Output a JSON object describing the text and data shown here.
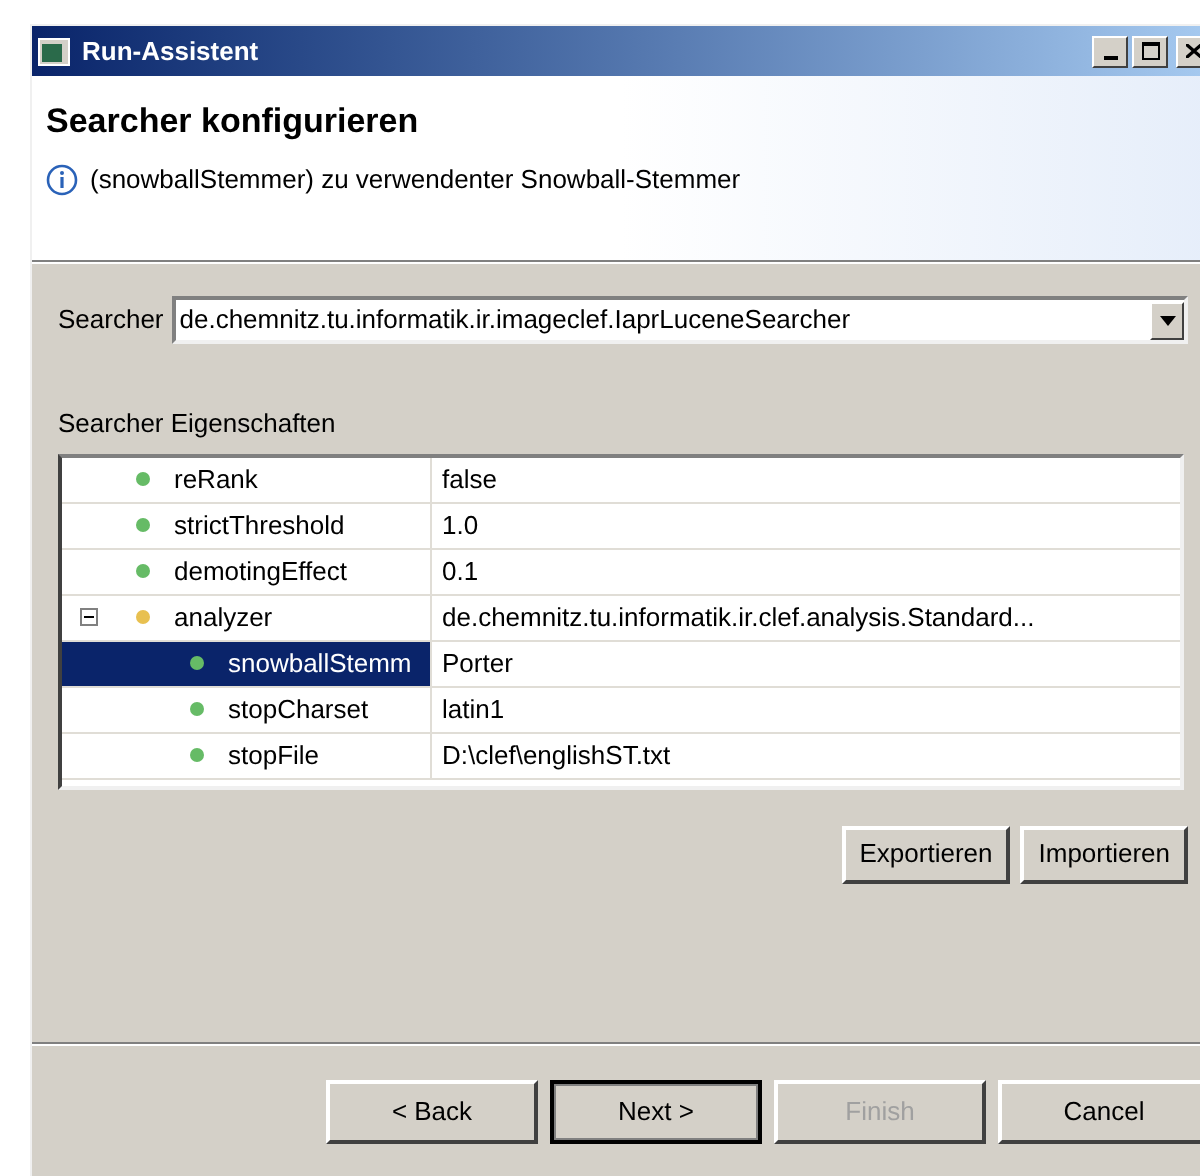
{
  "window": {
    "title": "Run-Assistent"
  },
  "header": {
    "title": "Searcher konfigurieren",
    "message": "(snowballStemmer) zu verwendenter Snowball-Stemmer"
  },
  "searcher": {
    "label": "Searcher",
    "value": "de.chemnitz.tu.informatik.ir.imageclef.IaprLuceneSearcher"
  },
  "properties": {
    "label": "Searcher Eigenschaften",
    "rows": [
      {
        "name": "reRank",
        "value": "false",
        "color": "#66bb66",
        "selected": false
      },
      {
        "name": "strictThreshold",
        "value": "1.0",
        "color": "#66bb66",
        "selected": false
      },
      {
        "name": "demotingEffect",
        "value": "0.1",
        "color": "#66bb66",
        "selected": false
      },
      {
        "name": "analyzer",
        "value": "de.chemnitz.tu.informatik.ir.clef.analysis.Standard...",
        "color": "#e8c050",
        "selected": false,
        "expanded": true,
        "children": [
          {
            "name": "snowballStemm",
            "value": "Porter",
            "color": "#66bb66",
            "selected": true
          },
          {
            "name": "stopCharset",
            "value": "latin1",
            "color": "#66bb66",
            "selected": false
          },
          {
            "name": "stopFile",
            "value": "D:\\clef\\englishST.txt",
            "color": "#66bb66",
            "selected": false
          }
        ]
      }
    ]
  },
  "property_buttons": [
    {
      "label": "Exportieren",
      "disabled": false
    },
    {
      "label": "Importieren",
      "disabled": false
    }
  ],
  "wizard_buttons": [
    {
      "label": "< Back",
      "disabled": false,
      "default": false
    },
    {
      "label": "Next >",
      "disabled": false,
      "default": true
    },
    {
      "label": "Finish",
      "disabled": true,
      "default": false
    },
    {
      "label": "Cancel",
      "disabled": false,
      "default": false
    }
  ]
}
